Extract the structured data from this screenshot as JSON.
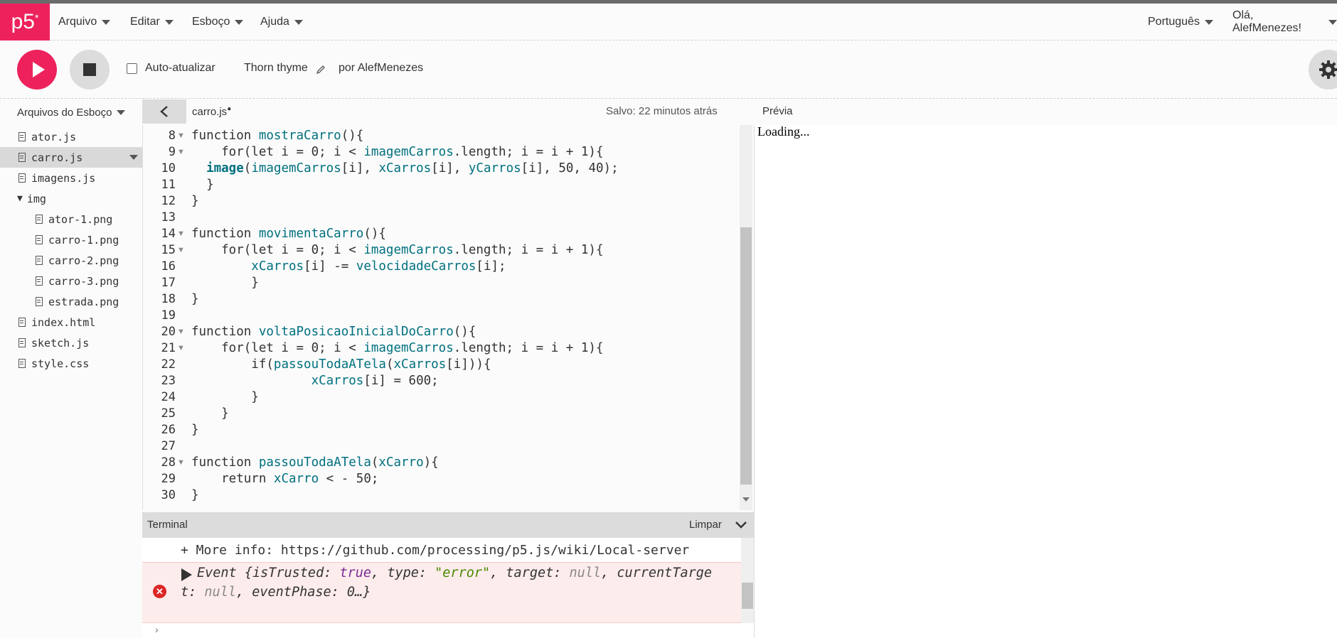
{
  "nav": {
    "logo": "p5",
    "logo_sup": "*",
    "menu": [
      "Arquivo",
      "Editar",
      "Esboço",
      "Ajuda"
    ],
    "language": "Português",
    "user": "Olá, AlefMenezes!"
  },
  "toolbar": {
    "auto_refresh_label": "Auto-atualizar",
    "auto_refresh_checked": false,
    "sketch_name": "Thorn thyme",
    "author": "por AlefMenezes"
  },
  "files_header": "Arquivos do Esboço",
  "file_tab": "carro.js",
  "saved_status": "Salvo: 22 minutos atrás",
  "preview_label": "Prévia",
  "preview_text": "Loading...",
  "files": [
    {
      "name": "ator.js",
      "type": "file"
    },
    {
      "name": "carro.js",
      "type": "file",
      "selected": true
    },
    {
      "name": "imagens.js",
      "type": "file"
    },
    {
      "name": "img",
      "type": "folder"
    },
    {
      "name": "ator-1.png",
      "type": "file",
      "nested": true
    },
    {
      "name": "carro-1.png",
      "type": "file",
      "nested": true
    },
    {
      "name": "carro-2.png",
      "type": "file",
      "nested": true
    },
    {
      "name": "carro-3.png",
      "type": "file",
      "nested": true
    },
    {
      "name": "estrada.png",
      "type": "file",
      "nested": true
    },
    {
      "name": "index.html",
      "type": "file"
    },
    {
      "name": "sketch.js",
      "type": "file"
    },
    {
      "name": "style.css",
      "type": "file"
    }
  ],
  "code_lines": [
    {
      "n": "8",
      "fold": true,
      "text": "function mostraCarro(){"
    },
    {
      "n": "9",
      "fold": true,
      "text": "    for(let i = 0; i < imagemCarros.length; i = i + 1){"
    },
    {
      "n": "10",
      "fold": false,
      "text": "  image(imagemCarros[i], xCarros[i], yCarros[i], 50, 40);"
    },
    {
      "n": "11",
      "fold": false,
      "text": "  }"
    },
    {
      "n": "12",
      "fold": false,
      "text": "}"
    },
    {
      "n": "13",
      "fold": false,
      "text": ""
    },
    {
      "n": "14",
      "fold": true,
      "text": "function movimentaCarro(){"
    },
    {
      "n": "15",
      "fold": true,
      "text": "    for(let i = 0; i < imagemCarros.length; i = i + 1){"
    },
    {
      "n": "16",
      "fold": false,
      "text": "        xCarros[i] -= velocidadeCarros[i];"
    },
    {
      "n": "17",
      "fold": false,
      "text": "        }"
    },
    {
      "n": "18",
      "fold": false,
      "text": "}"
    },
    {
      "n": "19",
      "fold": false,
      "text": ""
    },
    {
      "n": "20",
      "fold": true,
      "text": "function voltaPosicaoInicialDoCarro(){"
    },
    {
      "n": "21",
      "fold": true,
      "text": "    for(let i = 0; i < imagemCarros.length; i = i + 1){"
    },
    {
      "n": "22",
      "fold": false,
      "text": "        if(passouTodaATela(xCarros[i])){"
    },
    {
      "n": "23",
      "fold": false,
      "text": "                xCarros[i] = 600;"
    },
    {
      "n": "24",
      "fold": false,
      "text": "        }"
    },
    {
      "n": "25",
      "fold": false,
      "text": "    }"
    },
    {
      "n": "26",
      "fold": false,
      "text": "}"
    },
    {
      "n": "27",
      "fold": false,
      "text": ""
    },
    {
      "n": "28",
      "fold": true,
      "text": "function passouTodaATela(xCarro){"
    },
    {
      "n": "29",
      "fold": false,
      "text": "    return xCarro < - 50;"
    },
    {
      "n": "30",
      "fold": false,
      "text": "}"
    }
  ],
  "console": {
    "title": "Terminal",
    "clear": "Limpar",
    "info": "+ More info: https://github.com/processing/p5.js/wiki/Local-server",
    "error_line1": "Event {isTrusted: true, type: \"error\", target: null, currentTarge",
    "error_line2": "t: null, eventPhase: 0…}",
    "prompt": "›"
  },
  "colors": {
    "accent": "#ed225d",
    "code_identifier": "#00707f",
    "error_bg": "#fdecec",
    "error_icon": "#dc2626"
  }
}
